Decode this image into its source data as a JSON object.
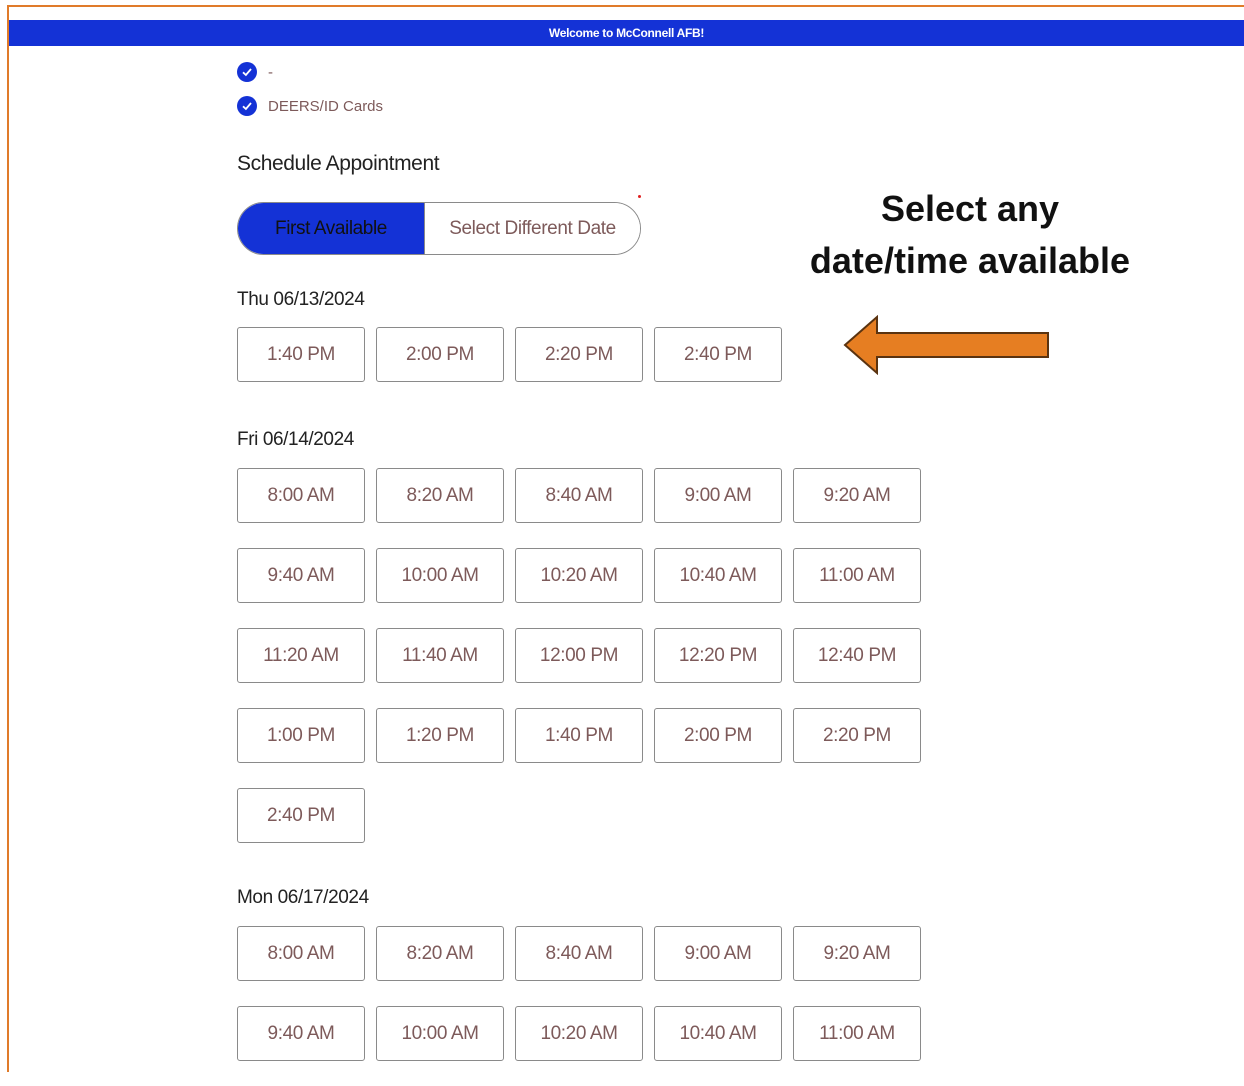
{
  "banner": {
    "text": "Welcome to McConnell AFB!"
  },
  "steps": [
    {
      "label": "-",
      "icon": "check-icon"
    },
    {
      "label": "DEERS/ID Cards",
      "icon": "check-icon"
    }
  ],
  "schedule": {
    "heading": "Schedule Appointment",
    "toggle": {
      "active": "First Available",
      "inactive": "Select Different Date"
    }
  },
  "callout": {
    "line1": "Select any",
    "line2": "date/time available",
    "arrow_color": "#e67e22"
  },
  "days": [
    {
      "date": "Thu 06/13/2024",
      "slots": [
        "1:40 PM",
        "2:00 PM",
        "2:20 PM",
        "2:40 PM"
      ]
    },
    {
      "date": "Fri 06/14/2024",
      "slots": [
        "8:00 AM",
        "8:20 AM",
        "8:40 AM",
        "9:00 AM",
        "9:20 AM",
        "9:40 AM",
        "10:00 AM",
        "10:20 AM",
        "10:40 AM",
        "11:00 AM",
        "11:20 AM",
        "11:40 AM",
        "12:00 PM",
        "12:20 PM",
        "12:40 PM",
        "1:00 PM",
        "1:20 PM",
        "1:40 PM",
        "2:00 PM",
        "2:20 PM",
        "2:40 PM"
      ]
    },
    {
      "date": "Mon 06/17/2024",
      "slots": [
        "8:00 AM",
        "8:20 AM",
        "8:40 AM",
        "9:00 AM",
        "9:20 AM",
        "9:40 AM",
        "10:00 AM",
        "10:20 AM",
        "10:40 AM",
        "11:00 AM"
      ]
    }
  ],
  "colors": {
    "brand_blue": "#1432d6",
    "slot_text": "#7d5a5a",
    "frame_border": "#e07b2a"
  }
}
